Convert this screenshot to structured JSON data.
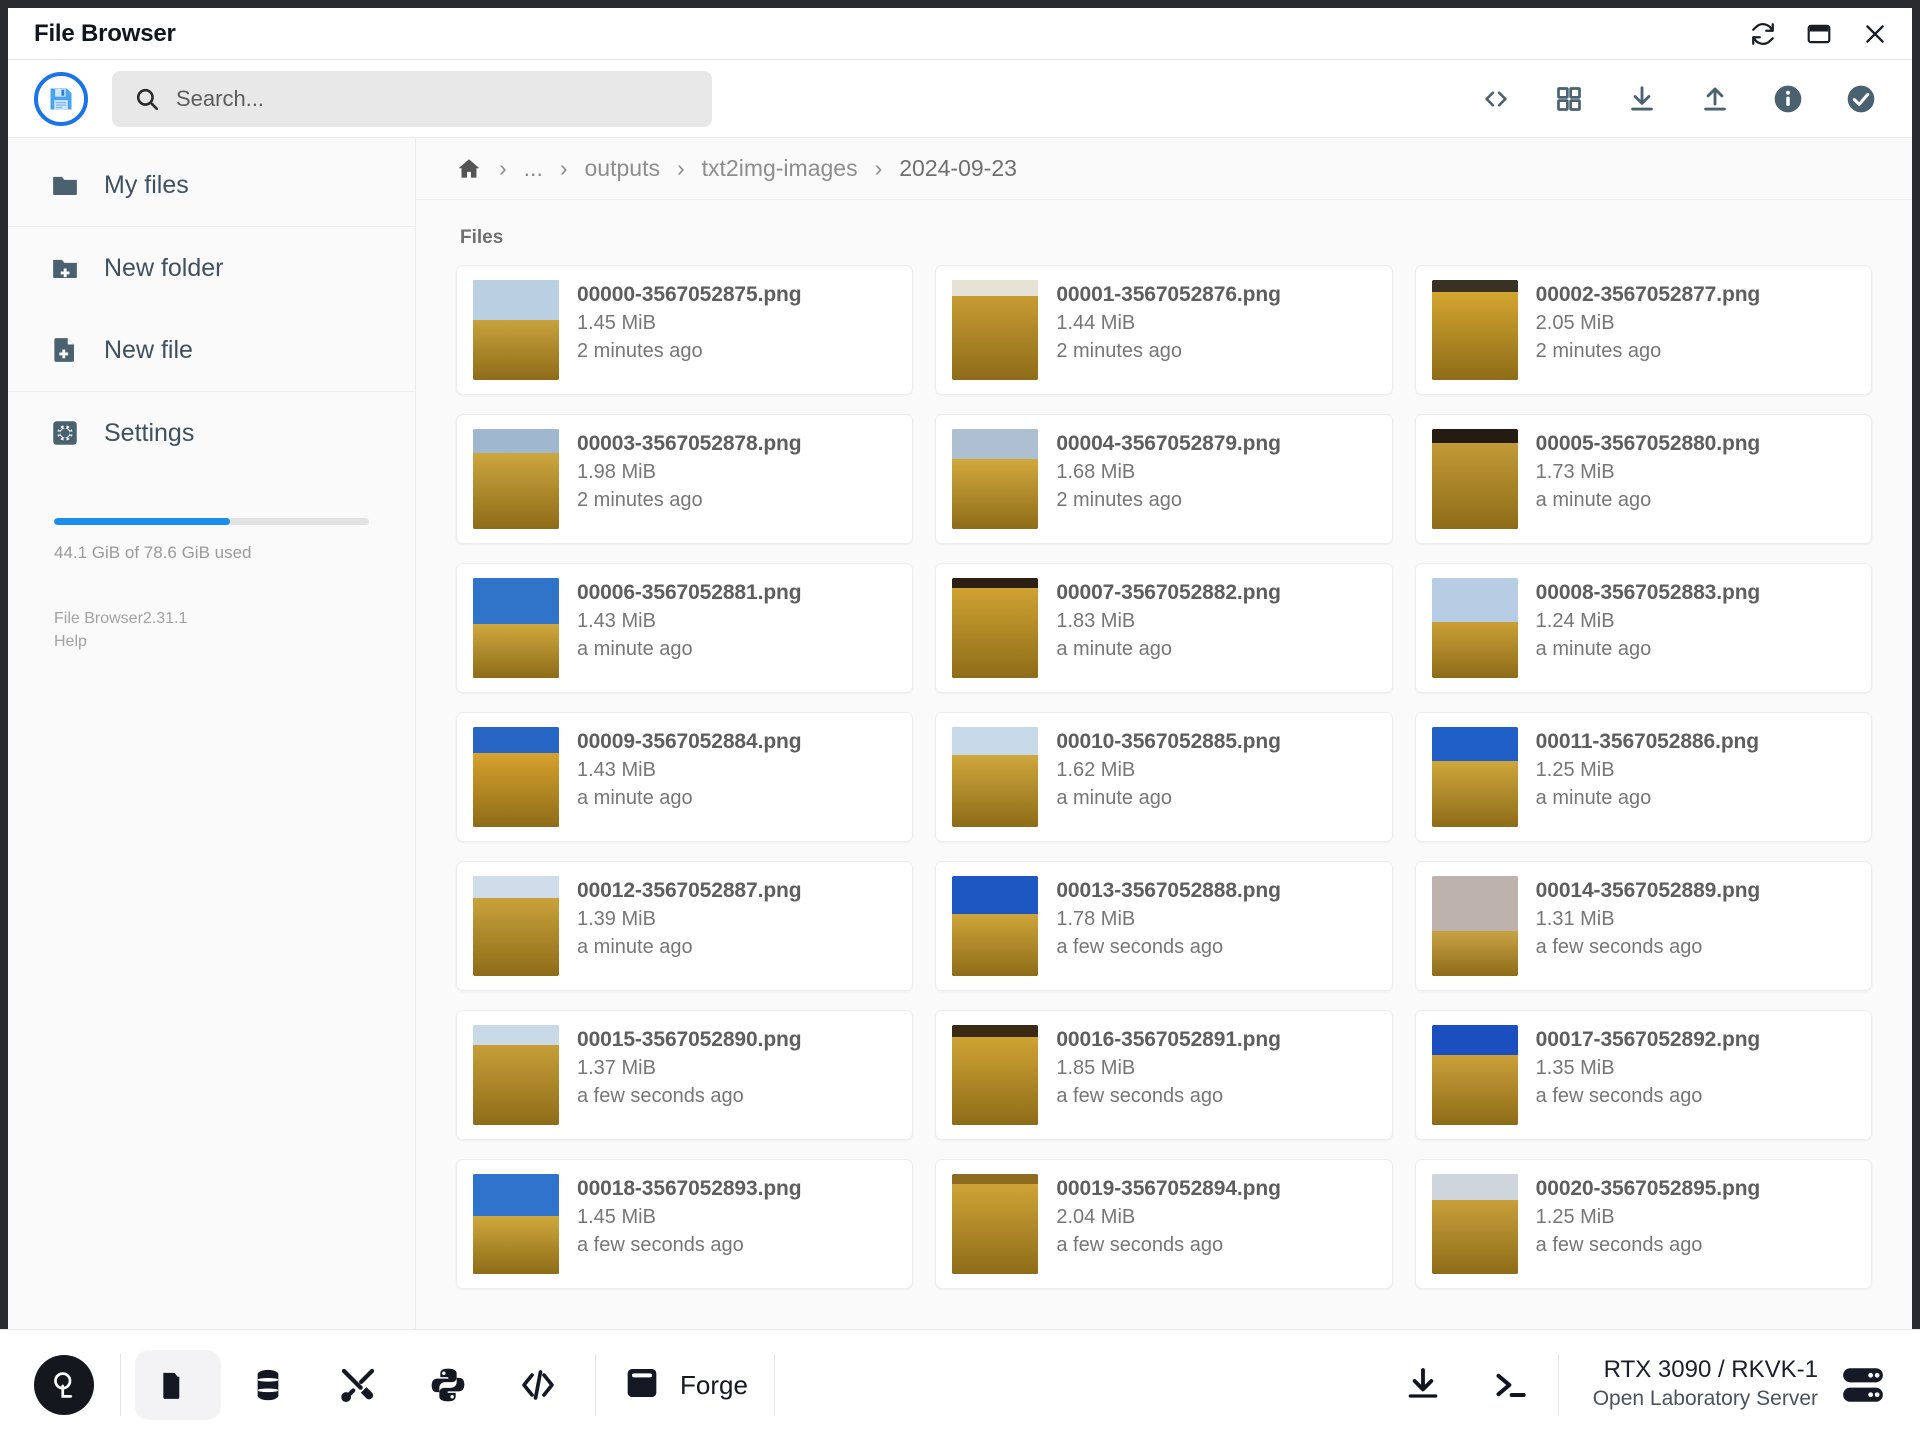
{
  "window": {
    "title": "File Browser",
    "controls": [
      {
        "name": "refresh",
        "label": "Refresh"
      },
      {
        "name": "window",
        "label": "Restore"
      },
      {
        "name": "close",
        "label": "Close"
      }
    ]
  },
  "toolbar": {
    "save_icon": "floppy-disk-icon",
    "search": {
      "placeholder": "Search...",
      "value": ""
    },
    "actions": [
      {
        "name": "code-icon",
        "label": "Shell / code"
      },
      {
        "name": "grid-view-icon",
        "label": "Switch view"
      },
      {
        "name": "download-icon",
        "label": "Download"
      },
      {
        "name": "upload-icon",
        "label": "Upload"
      },
      {
        "name": "info-icon",
        "label": "Info"
      },
      {
        "name": "select-all-icon",
        "label": "Select multiple"
      }
    ]
  },
  "sidebar": {
    "items": [
      {
        "label": "My files",
        "icon": "folder-icon"
      },
      {
        "label": "New folder",
        "icon": "folder-plus-icon"
      },
      {
        "label": "New file",
        "icon": "file-plus-icon"
      },
      {
        "label": "Settings",
        "icon": "gear-icon"
      }
    ],
    "storage": {
      "percent": 56,
      "text": "44.1 GiB of 78.6 GiB used",
      "bar_color": "#1a8ee8"
    },
    "version": "File Browser2.31.1",
    "help": "Help"
  },
  "breadcrumb": {
    "home_icon": "home-icon",
    "items": [
      "...",
      "outputs",
      "txt2img-images",
      "2024-09-23"
    ],
    "separator": "›"
  },
  "main": {
    "section_label": "Files",
    "files": [
      {
        "name": "00000-3567052875.png",
        "size": "1.45 MiB",
        "time": "2 minutes ago",
        "sky": "#b9cfe2",
        "gold": "#c8a23c",
        "skyh": 40
      },
      {
        "name": "00001-3567052876.png",
        "size": "1.44 MiB",
        "time": "2 minutes ago",
        "sky": "#e7e2d6",
        "gold": "#c79b32",
        "skyh": 16
      },
      {
        "name": "00002-3567052877.png",
        "size": "2.05 MiB",
        "time": "2 minutes ago",
        "sky": "#3a3126",
        "gold": "#d3a62f",
        "skyh": 12
      },
      {
        "name": "00003-3567052878.png",
        "size": "1.98 MiB",
        "time": "2 minutes ago",
        "sky": "#9fb7cf",
        "gold": "#cda63f",
        "skyh": 24
      },
      {
        "name": "00004-3567052879.png",
        "size": "1.68 MiB",
        "time": "2 minutes ago",
        "sky": "#aebfd2",
        "gold": "#d1a93c",
        "skyh": 30
      },
      {
        "name": "00005-3567052880.png",
        "size": "1.73 MiB",
        "time": "a minute ago",
        "sky": "#241c12",
        "gold": "#c29a35",
        "skyh": 14
      },
      {
        "name": "00006-3567052881.png",
        "size": "1.43 MiB",
        "time": "a minute ago",
        "sky": "#2f74c8",
        "gold": "#cfa93e",
        "skyh": 46
      },
      {
        "name": "00007-3567052882.png",
        "size": "1.83 MiB",
        "time": "a minute ago",
        "sky": "#2a1f12",
        "gold": "#cfa231",
        "skyh": 10
      },
      {
        "name": "00008-3567052883.png",
        "size": "1.24 MiB",
        "time": "a minute ago",
        "sky": "#b7cde4",
        "gold": "#ca9f36",
        "skyh": 44
      },
      {
        "name": "00009-3567052884.png",
        "size": "1.43 MiB",
        "time": "a minute ago",
        "sky": "#2766c4",
        "gold": "#d8a22d",
        "skyh": 26
      },
      {
        "name": "00010-3567052885.png",
        "size": "1.62 MiB",
        "time": "a minute ago",
        "sky": "#c7d8e8",
        "gold": "#cfa73c",
        "skyh": 28
      },
      {
        "name": "00011-3567052886.png",
        "size": "1.25 MiB",
        "time": "a minute ago",
        "sky": "#1f5fc6",
        "gold": "#cfa63b",
        "skyh": 34
      },
      {
        "name": "00012-3567052887.png",
        "size": "1.39 MiB",
        "time": "a minute ago",
        "sky": "#cfdce9",
        "gold": "#c9a23b",
        "skyh": 22
      },
      {
        "name": "00013-3567052888.png",
        "size": "1.78 MiB",
        "time": "a few seconds ago",
        "sky": "#1d57c2",
        "gold": "#cfa53a",
        "skyh": 38
      },
      {
        "name": "00014-3567052889.png",
        "size": "1.31 MiB",
        "time": "a few seconds ago",
        "sky": "#bdb2ad",
        "gold": "#c9a244",
        "skyh": 55
      },
      {
        "name": "00015-3567052890.png",
        "size": "1.37 MiB",
        "time": "a few seconds ago",
        "sky": "#cad9e7",
        "gold": "#c79e38",
        "skyh": 20
      },
      {
        "name": "00016-3567052891.png",
        "size": "1.85 MiB",
        "time": "a few seconds ago",
        "sky": "#3a2a14",
        "gold": "#cfa333",
        "skyh": 12
      },
      {
        "name": "00017-3567052892.png",
        "size": "1.35 MiB",
        "time": "a few seconds ago",
        "sky": "#1b4fc0",
        "gold": "#cba03a",
        "skyh": 30
      },
      {
        "name": "00018-3567052893.png",
        "size": "1.45 MiB",
        "time": "a few seconds ago",
        "sky": "#2f73cd",
        "gold": "#cfa83d",
        "skyh": 42
      },
      {
        "name": "00019-3567052894.png",
        "size": "2.04 MiB",
        "time": "a few seconds ago",
        "sky": "#8d6c22",
        "gold": "#cfa336",
        "skyh": 10
      },
      {
        "name": "00020-3567052895.png",
        "size": "1.25 MiB",
        "time": "a few seconds ago",
        "sky": "#ced5dc",
        "gold": "#c8a03a",
        "skyh": 26
      }
    ]
  },
  "taskbar": {
    "logo": "ql-logo-icon",
    "apps": [
      {
        "name": "files-icon",
        "label": "Files",
        "active": true
      },
      {
        "name": "database-icon",
        "label": "Database",
        "active": false
      },
      {
        "name": "tools-icon",
        "label": "Tools",
        "active": false
      },
      {
        "name": "python-icon",
        "label": "Python",
        "active": false
      },
      {
        "name": "code-icon",
        "label": "Code",
        "active": false
      }
    ],
    "forge": {
      "label": "Forge",
      "icon": "forge-icon"
    },
    "tray": [
      {
        "name": "downloads-icon",
        "label": "Downloads"
      },
      {
        "name": "terminal-icon",
        "label": "Terminal"
      }
    ],
    "host": {
      "name": "RTX 3090 / RKVK-1",
      "subtitle": "Open Laboratory Server",
      "icon": "server-icon"
    }
  }
}
